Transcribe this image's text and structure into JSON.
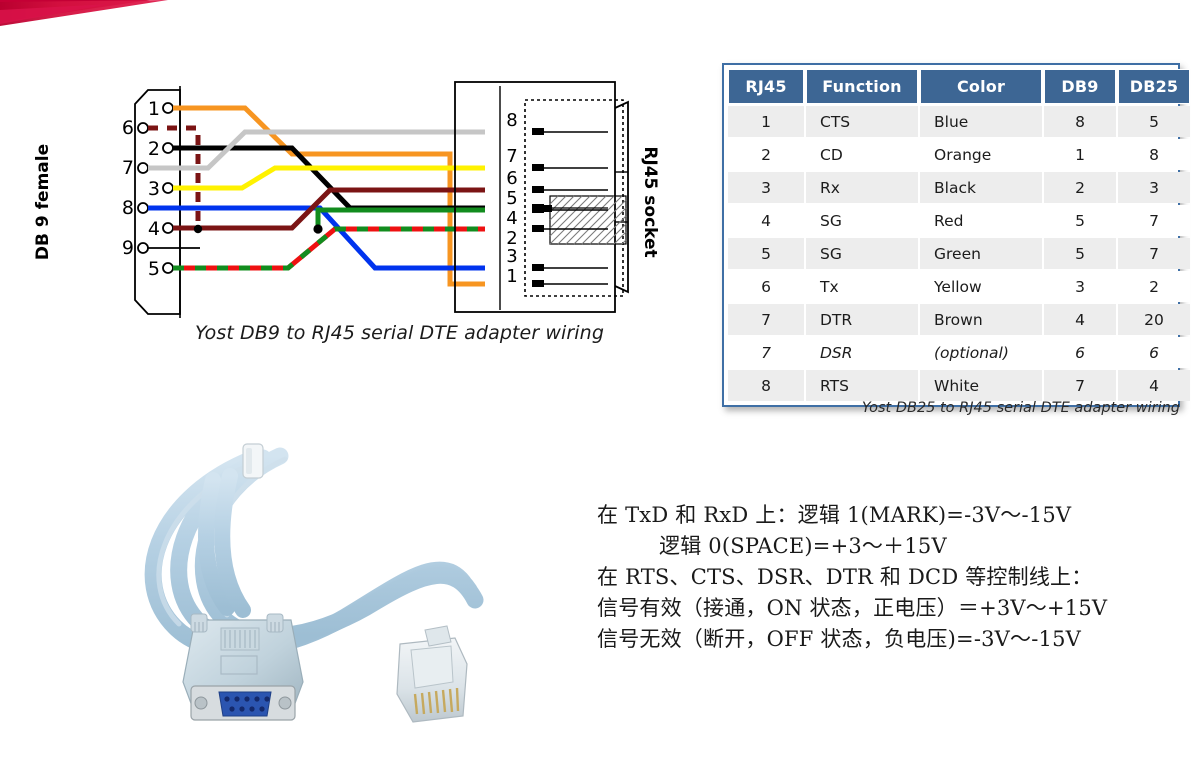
{
  "decoration": {
    "swoosh_color": "#d3103f",
    "swoosh_color_dark": "#a8002e",
    "name": "red-diagonal-banner"
  },
  "wiring_diagram": {
    "left_label": "DB 9 female",
    "right_label": "RJ45 socket",
    "db9_pins": [
      "1",
      "6",
      "2",
      "7",
      "3",
      "8",
      "4",
      "9",
      "5"
    ],
    "rj45_pins": [
      "8",
      "7",
      "6",
      "5",
      "4",
      "3",
      "2",
      "1"
    ],
    "caption": "Yost DB9 to RJ45 serial DTE adapter wiring",
    "wire_colors": {
      "orange": "#f79521",
      "black": "#000000",
      "grey": "#c6c6c6",
      "yellow": "#fff200",
      "blue": "#0033ee",
      "brown": "#7b1414",
      "red": "#ee1111",
      "green": "#128c1e",
      "white": "#ffffff"
    }
  },
  "table": {
    "headers": [
      "RJ45",
      "Function",
      "Color",
      "DB9",
      "DB25"
    ],
    "rows": [
      {
        "rj45": "1",
        "function": "CTS",
        "color": "Blue",
        "db9": "8",
        "db25": "5",
        "italic": false
      },
      {
        "rj45": "2",
        "function": "CD",
        "color": "Orange",
        "db9": "1",
        "db25": "8",
        "italic": false
      },
      {
        "rj45": "3",
        "function": "Rx",
        "color": "Black",
        "db9": "2",
        "db25": "3",
        "italic": false
      },
      {
        "rj45": "4",
        "function": "SG",
        "color": "Red",
        "db9": "5",
        "db25": "7",
        "italic": false
      },
      {
        "rj45": "5",
        "function": "SG",
        "color": "Green",
        "db9": "5",
        "db25": "7",
        "italic": false
      },
      {
        "rj45": "6",
        "function": "Tx",
        "color": "Yellow",
        "db9": "3",
        "db25": "2",
        "italic": false
      },
      {
        "rj45": "7",
        "function": "DTR",
        "color": "Brown",
        "db9": "4",
        "db25": "20",
        "italic": false
      },
      {
        "rj45": "7",
        "function": "DSR",
        "color": "(optional)",
        "db9": "6",
        "db25": "6",
        "italic": true
      },
      {
        "rj45": "8",
        "function": "RTS",
        "color": "White",
        "db9": "7",
        "db25": "4",
        "italic": false
      }
    ],
    "caption": "Yost DB25 to RJ45 serial DTE adapter wiring",
    "header_bg": "#3d6694",
    "border_color": "#3f6fa5",
    "alt_row_bg": "#ededed"
  },
  "photo": {
    "alt": "light blue flat console cable with DB9 female connector and RJ45 plug",
    "cable_color": "#bcd6e8",
    "connector_color": "#c3d4de"
  },
  "spec_text": {
    "line1": "在 TxD 和 RxD 上：逻辑 1(MARK)=-3V～-15V",
    "line2": "逻辑 0(SPACE)=+3～＋15V",
    "line3": "在 RTS、CTS、DSR、DTR 和 DCD 等控制线上：",
    "line4": "信号有效（接通，ON 状态，正电压）＝+3V～+15V",
    "line5": "信号无效（断开，OFF 状态，负电压)=-3V～-15V"
  }
}
